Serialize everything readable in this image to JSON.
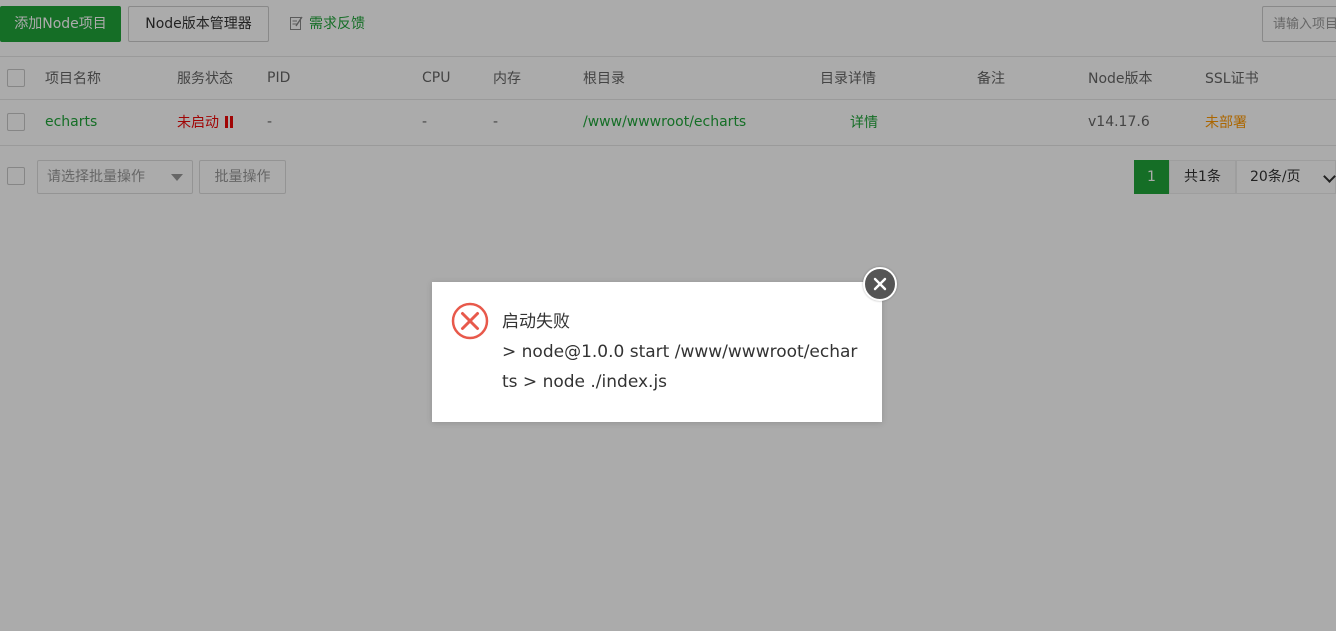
{
  "toolbar": {
    "add_button": "添加Node项目",
    "version_manager_button": "Node版本管理器",
    "feedback_link": "需求反馈",
    "search_placeholder": "请输入项目"
  },
  "table": {
    "columns": [
      "项目名称",
      "服务状态",
      "PID",
      "CPU",
      "内存",
      "根目录",
      "目录详情",
      "备注",
      "Node版本",
      "SSL证书"
    ],
    "rows": [
      {
        "name": "echarts",
        "status": "未启动",
        "pid": "-",
        "cpu": "-",
        "memory": "-",
        "root": "/www/wwwroot/echarts",
        "detail": "详情",
        "remark": "",
        "node_version": "v14.17.6",
        "ssl": "未部署"
      }
    ]
  },
  "batch": {
    "select_placeholder": "请选择批量操作",
    "button": "批量操作"
  },
  "pager": {
    "current_page": "1",
    "total": "共1条",
    "page_size": "20条/页"
  },
  "dialog": {
    "title": "启动失败",
    "line1": "> node@1.0.0 start /www/wwwroot/echar",
    "line2": "ts > node ./index.js"
  },
  "colors": {
    "primary": "#20a53a",
    "danger": "#ef0808",
    "warning": "#ff9900",
    "error_icon": "#e8594b"
  },
  "icons": {
    "feedback": "edit-icon",
    "status": "pause-icon",
    "dialog": "error-circle-icon",
    "close": "close-icon"
  }
}
